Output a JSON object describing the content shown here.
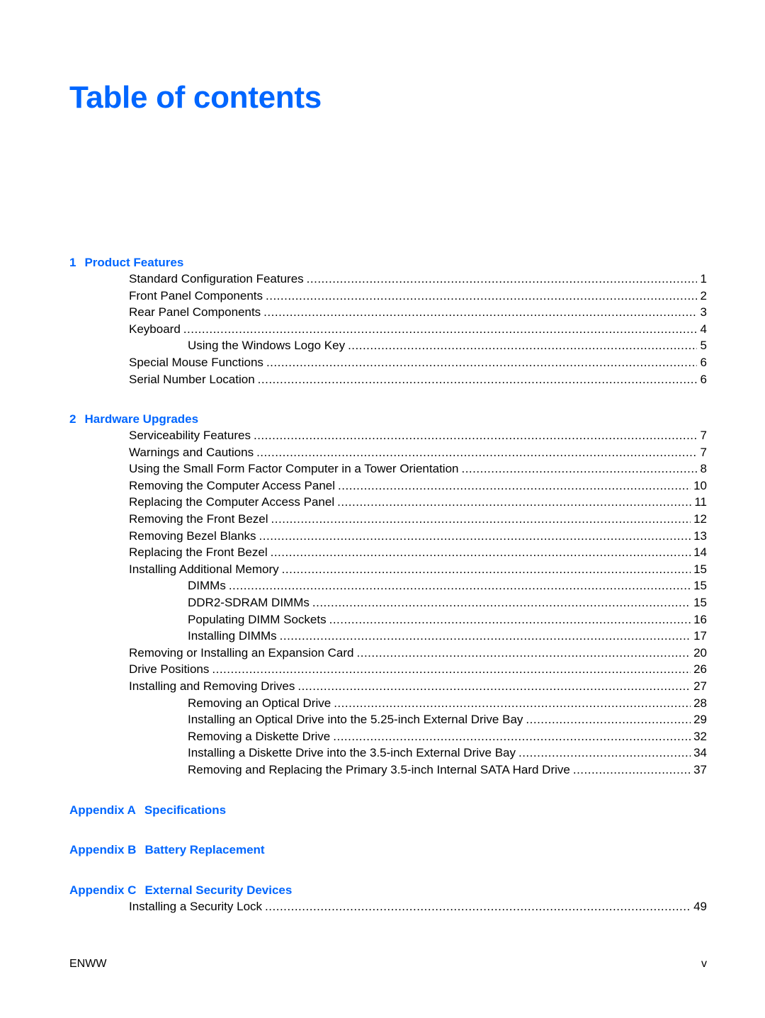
{
  "title": "Table of contents",
  "sections": [
    {
      "number": "1",
      "title": "Product Features",
      "entries": [
        {
          "label": "Standard Configuration Features",
          "page": "1",
          "level": 1
        },
        {
          "label": "Front Panel Components",
          "page": "2",
          "level": 1
        },
        {
          "label": "Rear Panel Components",
          "page": "3",
          "level": 1
        },
        {
          "label": "Keyboard",
          "page": "4",
          "level": 1
        },
        {
          "label": "Using the Windows Logo Key",
          "page": "5",
          "level": 2
        },
        {
          "label": "Special Mouse Functions",
          "page": "6",
          "level": 1
        },
        {
          "label": "Serial Number Location",
          "page": "6",
          "level": 1
        }
      ]
    },
    {
      "number": "2",
      "title": "Hardware Upgrades",
      "entries": [
        {
          "label": "Serviceability Features",
          "page": "7",
          "level": 1
        },
        {
          "label": "Warnings and Cautions",
          "page": "7",
          "level": 1
        },
        {
          "label": "Using the Small Form Factor Computer in a Tower Orientation",
          "page": "8",
          "level": 1
        },
        {
          "label": "Removing the Computer Access Panel",
          "page": "10",
          "level": 1
        },
        {
          "label": "Replacing the Computer Access Panel",
          "page": "11",
          "level": 1
        },
        {
          "label": "Removing the Front Bezel",
          "page": "12",
          "level": 1
        },
        {
          "label": "Removing Bezel Blanks",
          "page": "13",
          "level": 1
        },
        {
          "label": "Replacing the Front Bezel",
          "page": "14",
          "level": 1
        },
        {
          "label": "Installing Additional Memory",
          "page": "15",
          "level": 1
        },
        {
          "label": "DIMMs",
          "page": "15",
          "level": 2
        },
        {
          "label": "DDR2-SDRAM DIMMs",
          "page": "15",
          "level": 2
        },
        {
          "label": "Populating DIMM Sockets",
          "page": "16",
          "level": 2
        },
        {
          "label": "Installing DIMMs",
          "page": "17",
          "level": 2
        },
        {
          "label": "Removing or Installing an Expansion Card",
          "page": "20",
          "level": 1
        },
        {
          "label": "Drive Positions",
          "page": "26",
          "level": 1
        },
        {
          "label": "Installing and Removing Drives",
          "page": "27",
          "level": 1
        },
        {
          "label": "Removing an Optical Drive",
          "page": "28",
          "level": 2
        },
        {
          "label": "Installing an Optical Drive into the 5.25-inch External Drive Bay",
          "page": "29",
          "level": 2
        },
        {
          "label": "Removing a Diskette Drive",
          "page": "32",
          "level": 2
        },
        {
          "label": "Installing a Diskette Drive into the 3.5-inch External Drive Bay",
          "page": "34",
          "level": 2
        },
        {
          "label": "Removing and Replacing the Primary 3.5-inch Internal SATA Hard Drive",
          "page": "37",
          "level": 2
        }
      ]
    },
    {
      "number": "Appendix A",
      "title": "Specifications",
      "entries": []
    },
    {
      "number": "Appendix B",
      "title": "Battery Replacement",
      "entries": []
    },
    {
      "number": "Appendix C",
      "title": "External Security Devices",
      "entries": [
        {
          "label": "Installing a Security Lock",
          "page": "49",
          "level": 1
        }
      ]
    }
  ],
  "footer": {
    "left": "ENWW",
    "right": "v"
  },
  "colors": {
    "heading": "#0066ff",
    "text": "#000000"
  }
}
